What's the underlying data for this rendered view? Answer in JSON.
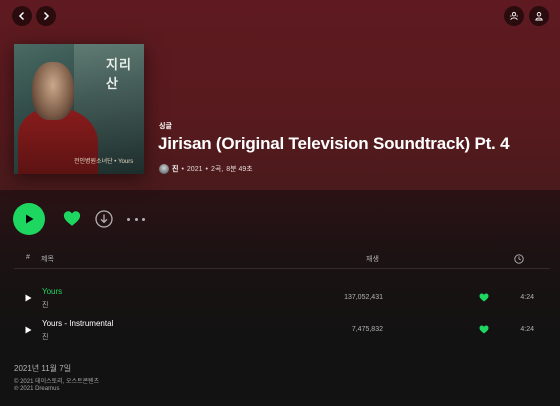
{
  "nav": {
    "back_icon": "chevron-left-icon",
    "forward_icon": "chevron-right-icon"
  },
  "topright": {
    "friends_icon": "friends-activity-icon",
    "user_icon": "user-icon"
  },
  "cover": {
    "logo_text": "지리산",
    "caption_text": "전인병원소녀단 • Yours"
  },
  "album": {
    "type": "싱글",
    "title": "Jirisan (Original Television Soundtrack) Pt. 4",
    "artist": "진",
    "year": "2021",
    "track_count": "2곡,",
    "duration": "8분 49초",
    "sep": "•"
  },
  "actions": {
    "play_icon": "play-icon",
    "like_icon": "heart-icon",
    "download_icon": "download-icon",
    "more_icon": "more-icon"
  },
  "table": {
    "header_num": "#",
    "header_title": "제목",
    "header_plays": "재생",
    "header_duration_icon": "clock-icon",
    "rows": [
      {
        "title": "Yours",
        "artist": "진",
        "plays": "137,052,431",
        "duration": "4:24",
        "active": true
      },
      {
        "title": "Yours - Instrumental",
        "artist": "진",
        "plays": "7,475,832",
        "duration": "4:24",
        "active": false
      }
    ]
  },
  "footer": {
    "release_date": "2021년 11월 7일",
    "copyright_c": "© 2021 데이스토리, 오스트콘텐츠",
    "copyright_p": "℗ 2021 Dreamus"
  },
  "colors": {
    "accent": "#1ed760",
    "hero": "#5e1a20",
    "bg": "#121212"
  }
}
